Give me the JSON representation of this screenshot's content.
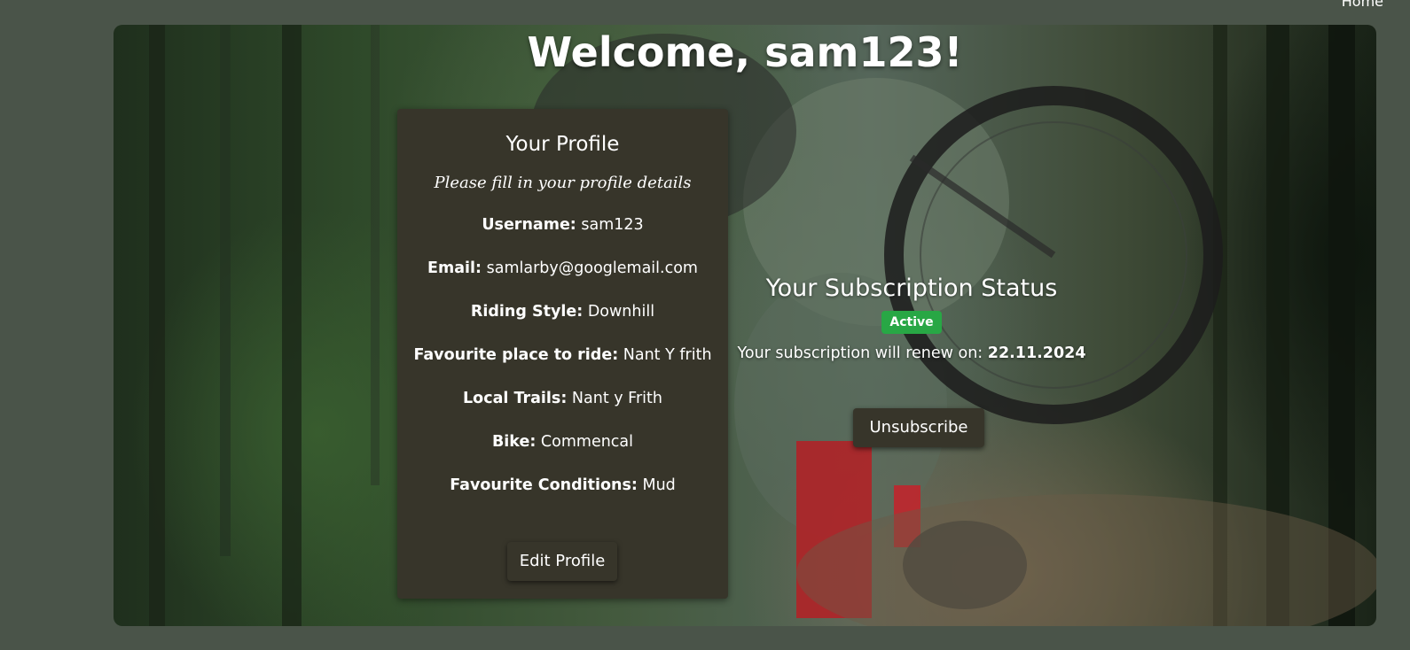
{
  "nav": {
    "home_label": "Home"
  },
  "page": {
    "title": "Welcome, sam123!"
  },
  "profile": {
    "heading": "Your Profile",
    "subtitle": "Please fill in your profile details",
    "fields": [
      {
        "label": "Username:",
        "value": "sam123"
      },
      {
        "label": "Email:",
        "value": "samlarby@googlemail.com"
      },
      {
        "label": "Riding Style:",
        "value": "Downhill"
      },
      {
        "label": "Favourite place to ride:",
        "value": "Nant Y frith"
      },
      {
        "label": "Local Trails:",
        "value": "Nant y Frith"
      },
      {
        "label": "Bike:",
        "value": "Commencal"
      },
      {
        "label": "Favourite Conditions:",
        "value": "Mud"
      }
    ],
    "edit_button": "Edit Profile"
  },
  "subscription": {
    "heading": "Your Subscription Status",
    "status_badge": "Active",
    "renew_text": "Your subscription will renew on:",
    "renew_date": "22.11.2024",
    "unsubscribe_button": "Unsubscribe"
  },
  "colors": {
    "page_background": "#4a5449",
    "card_background": "#37352a",
    "badge_active": "#28a745",
    "text": "#ffffff"
  }
}
